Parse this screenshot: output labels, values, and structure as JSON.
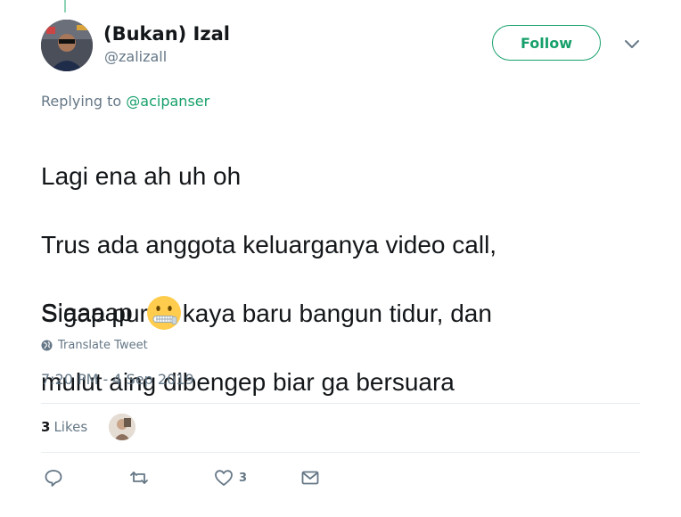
{
  "tweet": {
    "display_name": "(Bukan) Izal",
    "handle": "@zalizall",
    "follow_label": "Follow",
    "replying_prefix": "Replying to",
    "replying_to": "@acipanser",
    "text_lines": [
      "Lagi ena ah uh oh",
      "Trus ada anggota keluarganya video call,",
      "Sigap pura2 kaya baru bangun tidur, dan",
      "mulut aing dibengep biar ga bersuara"
    ],
    "final_line": "Siaaaap",
    "emoji": "zipper-mouth-face",
    "translate_label": "Translate Tweet",
    "timestamp": "7:20 PM - 4 Sep 2019",
    "likes_count": "3",
    "likes_label": "Likes",
    "action_like_count": "3"
  },
  "colors": {
    "accent": "#17a06b",
    "secondary_text": "#657786",
    "divider": "#e6ecf0"
  }
}
